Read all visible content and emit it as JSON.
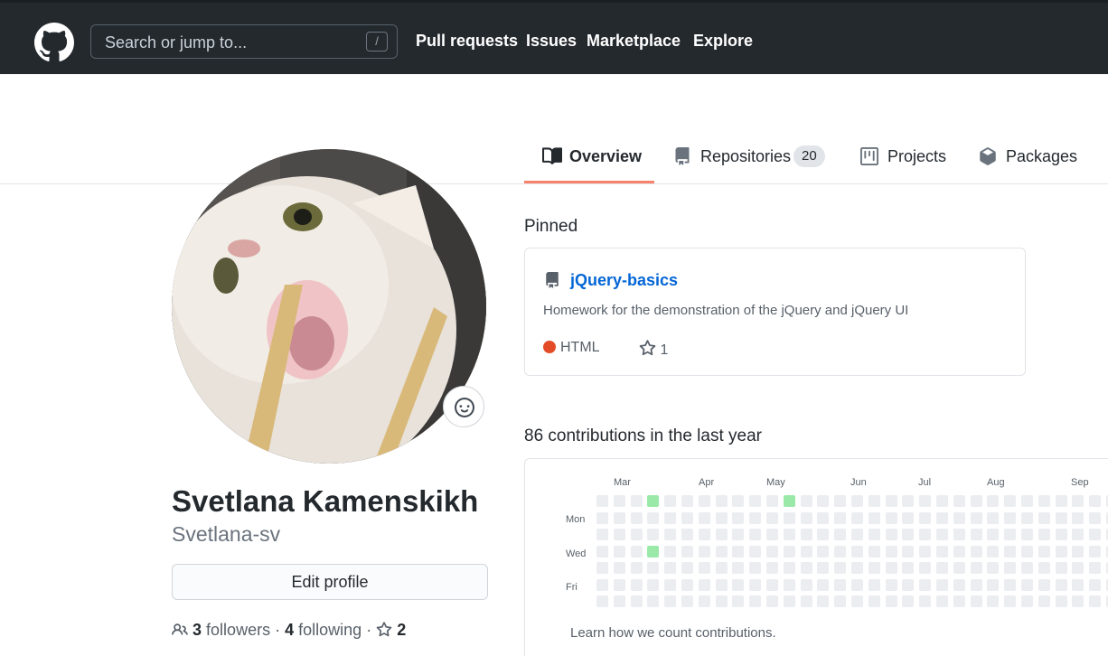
{
  "header": {
    "search_placeholder": "Search or jump to...",
    "search_shortcut": "/",
    "nav": [
      "Pull requests",
      "Issues",
      "Marketplace",
      "Explore"
    ]
  },
  "tabs": [
    {
      "label": "Overview",
      "icon": "book-icon",
      "selected": true
    },
    {
      "label": "Repositories",
      "icon": "repo-icon",
      "count": "20"
    },
    {
      "label": "Projects",
      "icon": "project-icon"
    },
    {
      "label": "Packages",
      "icon": "package-icon"
    }
  ],
  "profile": {
    "name": "Svetlana Kamenskikh",
    "login": "Svetlana-sv",
    "edit_label": "Edit profile",
    "followers_count": "3",
    "followers_label": "followers",
    "following_count": "4",
    "following_label": "following",
    "stars_count": "2"
  },
  "pinned": {
    "title": "Pinned",
    "repo": {
      "name": "jQuery-basics",
      "description": "Homework for the demonstration of the jQuery and jQuery UI",
      "language": "HTML",
      "language_color": "#e34c26",
      "stars": "1"
    }
  },
  "contributions": {
    "title": "86 contributions in the last year",
    "months": [
      "Mar",
      "Apr",
      "May",
      "Jun",
      "Jul",
      "Aug",
      "Sep"
    ],
    "days": [
      "Mon",
      "Wed",
      "Fri"
    ],
    "learn_link": "Learn how we count contributions.",
    "colors": {
      "empty": "#ebedf0",
      "level1": "#9be9a8"
    }
  }
}
